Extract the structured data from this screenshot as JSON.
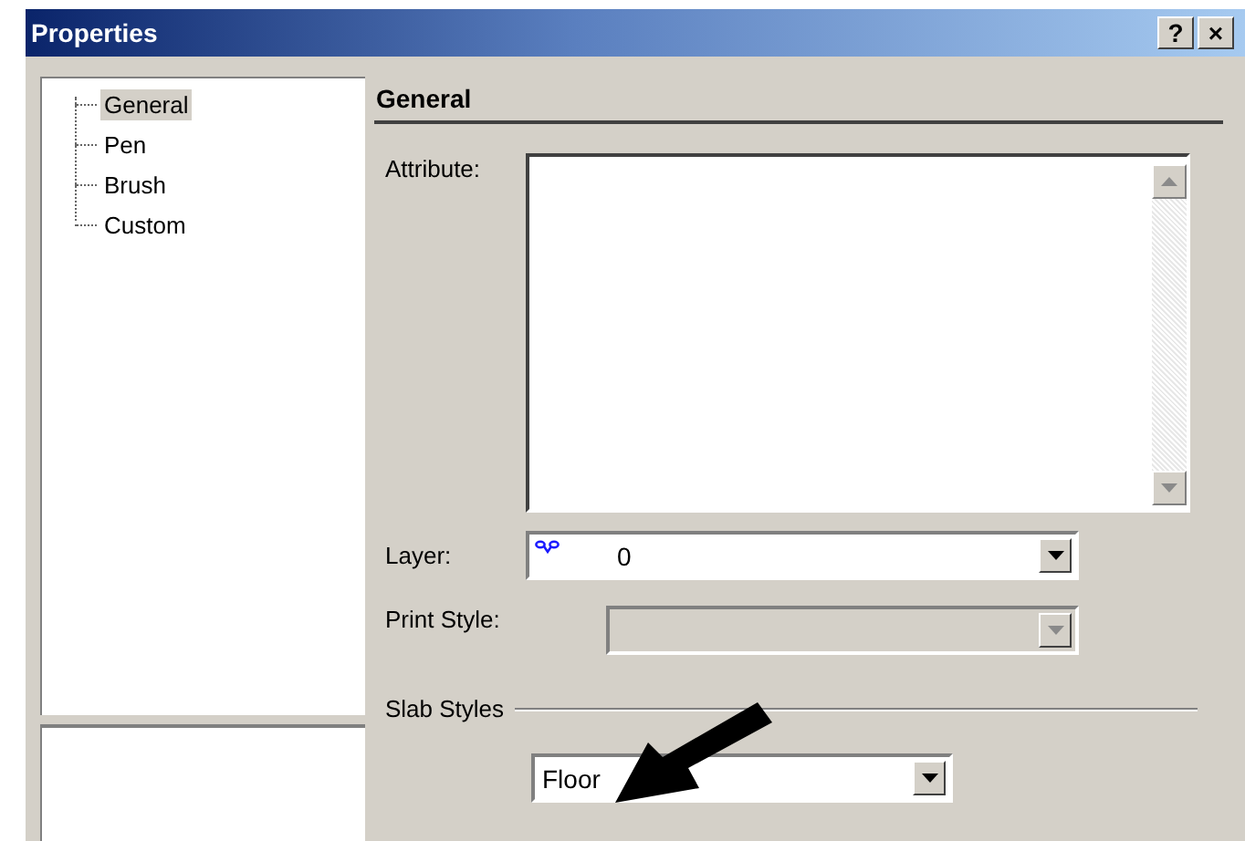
{
  "window": {
    "title": "Properties",
    "buttons": [
      "?",
      "×"
    ]
  },
  "tree": {
    "items": [
      {
        "label": "General",
        "selected": true
      },
      {
        "label": "Pen",
        "selected": false
      },
      {
        "label": "Brush",
        "selected": false
      },
      {
        "label": "Custom",
        "selected": false
      }
    ]
  },
  "section": {
    "title": "General"
  },
  "attribute": {
    "label": "Attribute:"
  },
  "layer": {
    "label": "Layer:",
    "value": "0",
    "disabled": false
  },
  "print_style": {
    "label": "Print Style:",
    "disabled": true
  },
  "slab_styles": {
    "label": "Slab Styles",
    "value": "Floor",
    "disabled": false
  }
}
